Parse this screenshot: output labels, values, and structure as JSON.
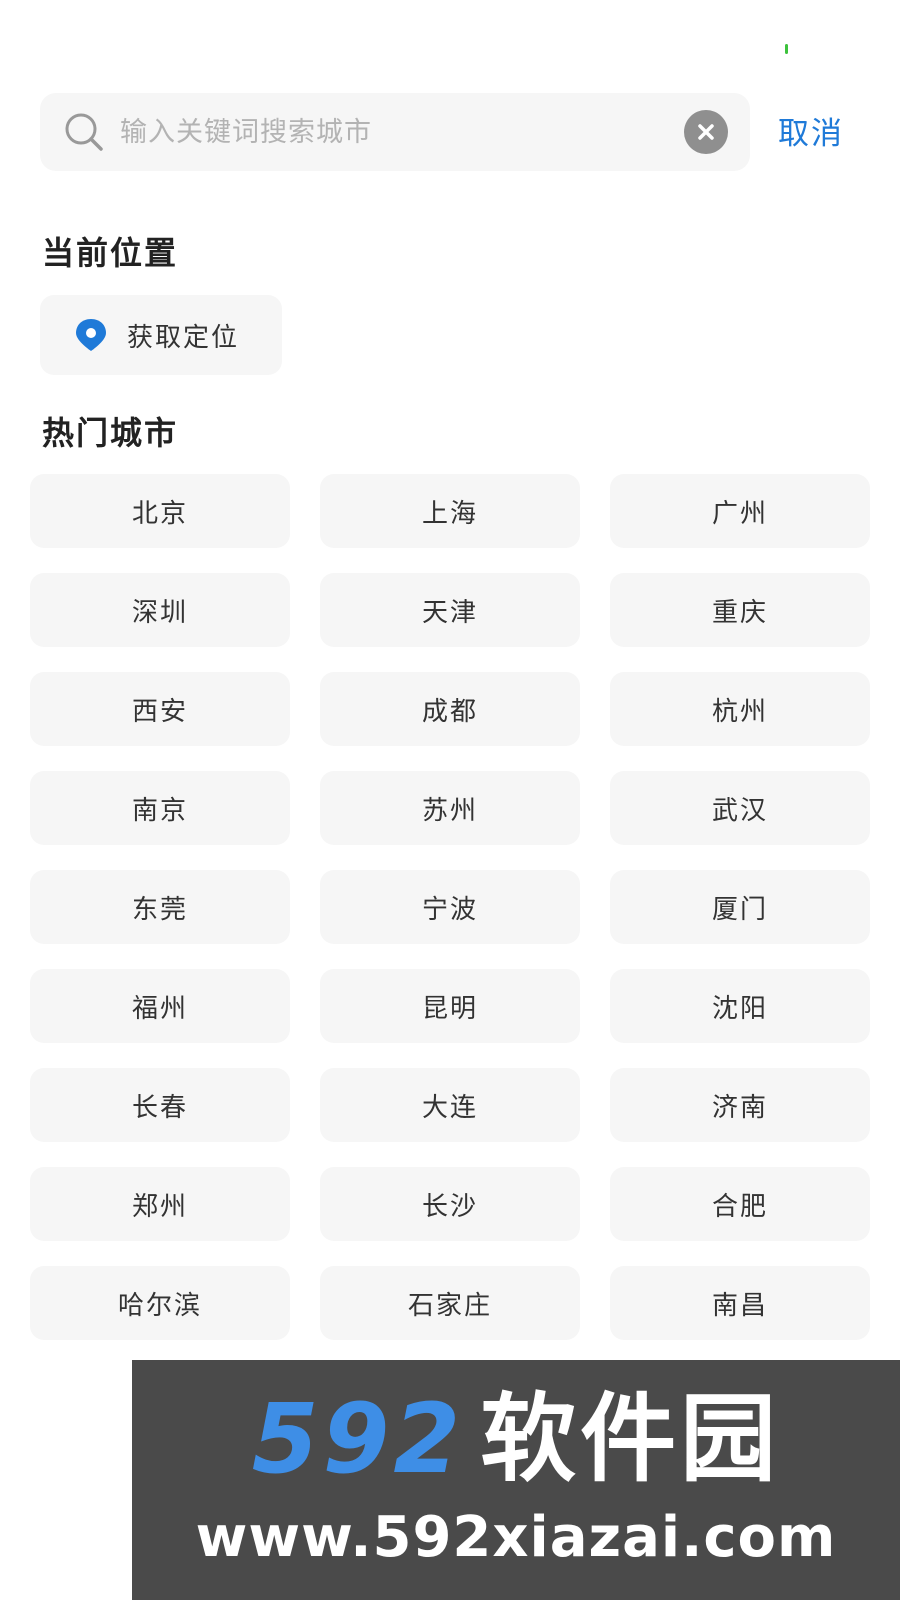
{
  "search": {
    "placeholder": "输入关键词搜索城市",
    "value": "",
    "cancel_label": "取消"
  },
  "current_location": {
    "title": "当前位置",
    "button_label": "获取定位",
    "accent_color": "#1f7ad8"
  },
  "hot_cities": {
    "title": "热门城市",
    "items": [
      "北京",
      "上海",
      "广州",
      "深圳",
      "天津",
      "重庆",
      "西安",
      "成都",
      "杭州",
      "南京",
      "苏州",
      "武汉",
      "东莞",
      "宁波",
      "厦门",
      "福州",
      "昆明",
      "沈阳",
      "长春",
      "大连",
      "济南",
      "郑州",
      "长沙",
      "合肥",
      "哈尔滨",
      "石家庄",
      "南昌"
    ]
  },
  "watermark": {
    "number": "592",
    "name": "软件园",
    "url": "www.592xiazai.com"
  }
}
